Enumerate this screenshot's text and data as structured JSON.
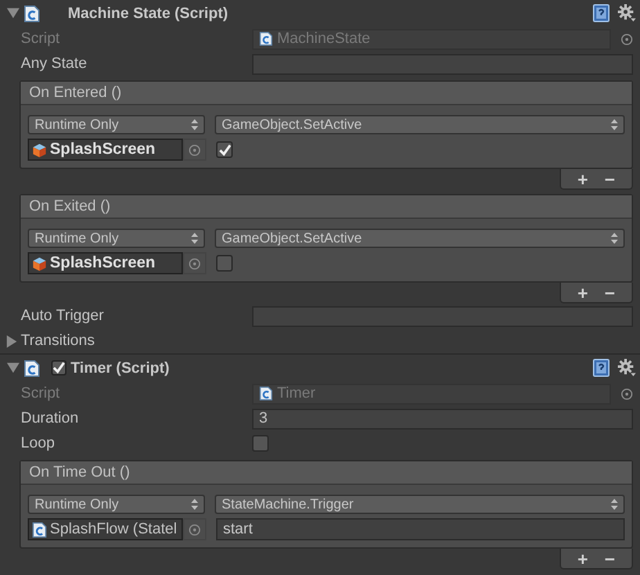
{
  "components": [
    {
      "title": "Machine State (Script)",
      "expanded": true,
      "fields": [
        {
          "kind": "script",
          "label": "Script",
          "value": "MachineState",
          "disabled": true
        },
        {
          "kind": "text",
          "label": "Any State"
        },
        {
          "kind": "event",
          "title": "On Entered ()",
          "listeners": [
            {
              "mode": "Runtime Only",
              "function": "GameObject.SetActive",
              "target": {
                "kind": "gameobject",
                "name": "SplashScreen"
              },
              "argument": {
                "kind": "toggle",
                "checked": true
              }
            }
          ],
          "footer_buttons": [
            "+",
            "−"
          ]
        },
        {
          "kind": "event",
          "title": "On Exited ()",
          "listeners": [
            {
              "mode": "Runtime Only",
              "function": "GameObject.SetActive",
              "target": {
                "kind": "gameobject",
                "name": "SplashScreen"
              },
              "argument": {
                "kind": "toggle",
                "checked": false
              }
            }
          ],
          "footer_buttons": [
            "+",
            "−"
          ]
        },
        {
          "kind": "text",
          "label": "Auto Trigger"
        },
        {
          "kind": "foldout",
          "label": "Transitions",
          "expanded": false
        }
      ]
    },
    {
      "title": "Timer (Script)",
      "expanded": true,
      "enabled": true,
      "fields": [
        {
          "kind": "script",
          "label": "Script",
          "value": "Timer",
          "disabled": true
        },
        {
          "kind": "text",
          "label": "Duration",
          "value": "3"
        },
        {
          "kind": "toggle",
          "label": "Loop",
          "checked": false
        },
        {
          "kind": "event",
          "title": "On Time Out ()",
          "listeners": [
            {
              "mode": "Runtime Only",
              "function": "StateMachine.Trigger",
              "target": {
                "kind": "script",
                "name": "SplashFlow (Statel"
              },
              "argument": {
                "kind": "text",
                "value": "start"
              }
            }
          ],
          "footer_buttons": [
            "+",
            "−"
          ]
        }
      ]
    }
  ]
}
